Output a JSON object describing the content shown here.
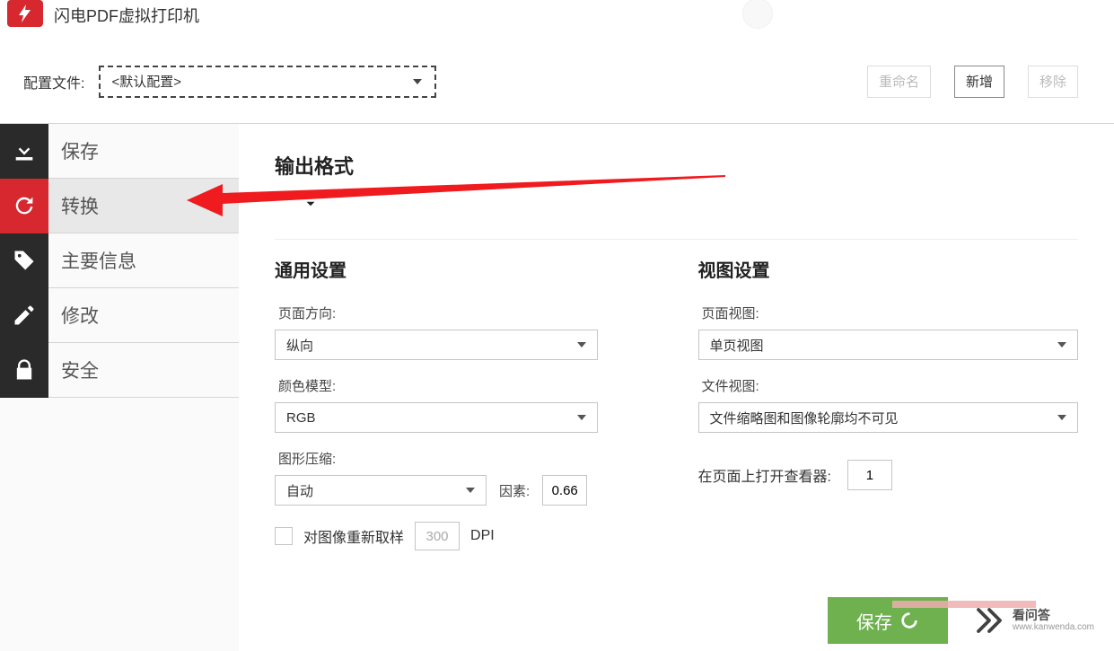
{
  "header": {
    "app_title": "闪电PDF虚拟打印机"
  },
  "profile": {
    "label": "配置文件:",
    "selected": "<默认配置>",
    "rename_label": "重命名",
    "add_label": "新增",
    "remove_label": "移除"
  },
  "sidebar": {
    "items": [
      {
        "label": "保存",
        "icon": "download"
      },
      {
        "label": "转换",
        "icon": "refresh"
      },
      {
        "label": "主要信息",
        "icon": "tag"
      },
      {
        "label": "修改",
        "icon": "pencil"
      },
      {
        "label": "安全",
        "icon": "lock"
      }
    ]
  },
  "content": {
    "output_format_title": "输出格式",
    "general_title": "通用设置",
    "view_title": "视图设置",
    "page_orientation_label": "页面方向:",
    "page_orientation_value": "纵向",
    "color_model_label": "颜色模型:",
    "color_model_value": "RGB",
    "compression_label": "图形压缩:",
    "compression_value": "自动",
    "factor_label": "因素:",
    "factor_value": "0.66",
    "resample_label": "对图像重新取样",
    "resample_dpi": "300",
    "dpi_suffix": "DPI",
    "page_view_label": "页面视图:",
    "page_view_value": "单页视图",
    "file_view_label": "文件视图:",
    "file_view_value": "文件缩略图和图像轮廓均不可见",
    "open_page_label": "在页面上打开查看器:",
    "open_page_value": "1"
  },
  "footer": {
    "save_label": "保存",
    "wm_name": "看问答",
    "wm_url": "www.kanwenda.com"
  }
}
